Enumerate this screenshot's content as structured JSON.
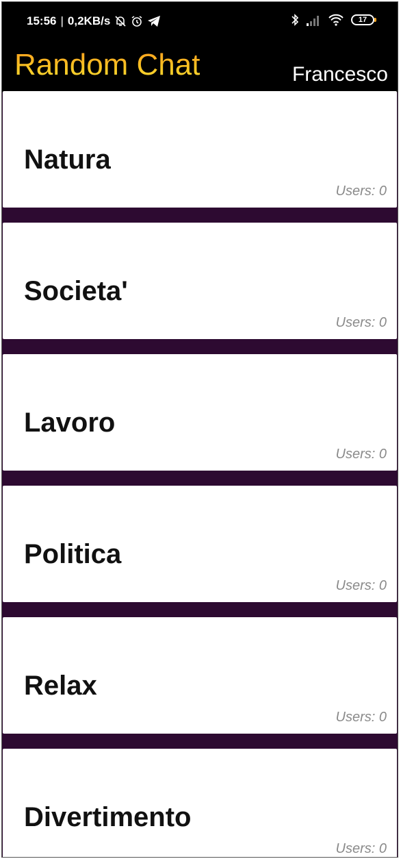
{
  "status_bar": {
    "time": "15:56",
    "separator": "|",
    "speed": "0,2KB/s",
    "battery": "17"
  },
  "app_bar": {
    "title": "Random Chat",
    "user": "Francesco"
  },
  "categories": [
    {
      "name": "Natura",
      "users": "Users: 0"
    },
    {
      "name": "Societa'",
      "users": "Users: 0"
    },
    {
      "name": "Lavoro",
      "users": "Users: 0"
    },
    {
      "name": "Politica",
      "users": "Users: 0"
    },
    {
      "name": "Relax",
      "users": "Users: 0"
    },
    {
      "name": "Divertimento",
      "users": "Users: 0"
    }
  ],
  "colors": {
    "background": "#2d0a31",
    "top_bar": "#000000",
    "title_gradient_start": "#ff9a1e",
    "title_gradient_end": "#f9dd3a",
    "card": "#ffffff",
    "users_text": "#8a8a8a"
  }
}
